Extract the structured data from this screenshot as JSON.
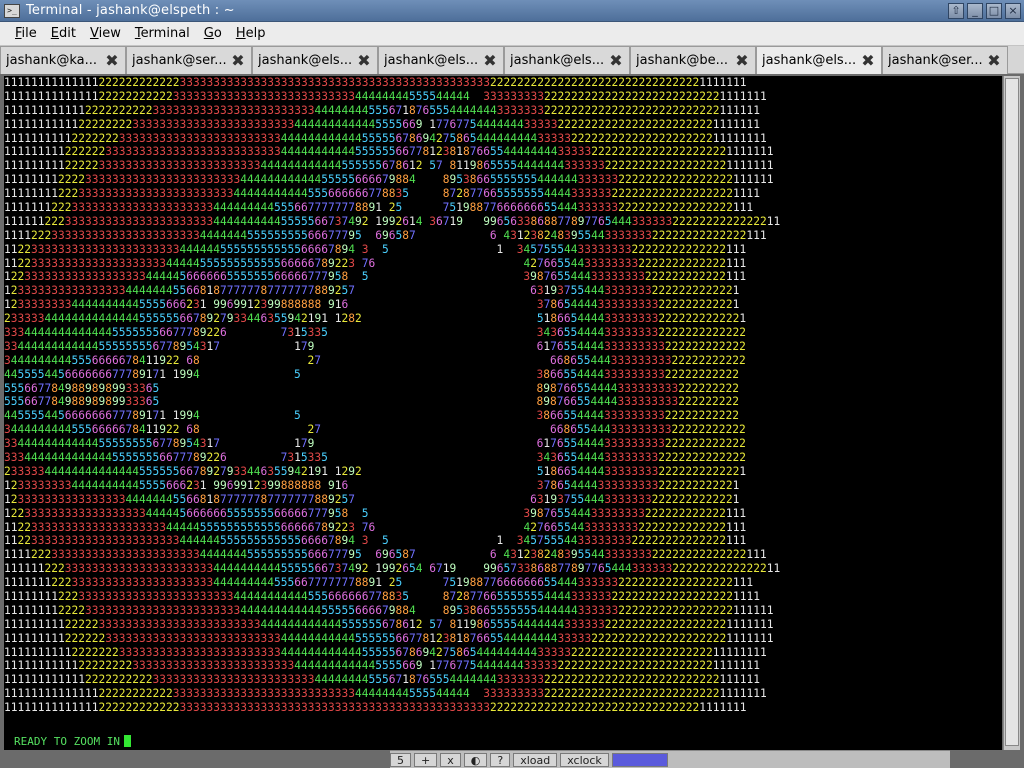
{
  "window": {
    "title": "Terminal - jashank@elspeth : ~"
  },
  "menu": [
    "File",
    "Edit",
    "View",
    "Terminal",
    "Go",
    "Help"
  ],
  "menu_mnemonic": [
    "F",
    "E",
    "V",
    "T",
    "G",
    "H"
  ],
  "tabs": [
    {
      "label": "jashank@ka..."
    },
    {
      "label": "jashank@ser..."
    },
    {
      "label": "jashank@els..."
    },
    {
      "label": "jashank@els..."
    },
    {
      "label": "jashank@els..."
    },
    {
      "label": "jashank@be..."
    },
    {
      "label": "jashank@els..."
    },
    {
      "label": "jashank@ser..."
    }
  ],
  "active_tab": 6,
  "terminal": {
    "status": "READY TO ZOOM IN",
    "colors": {
      "1": "#e8e8e8",
      "2": "#e8e83a",
      "3": "#e04848",
      "4": "#50e050",
      "5": "#4ad0ff",
      "6": "#e070e0",
      "7": "#7070ff",
      "8": "#ff9f40",
      "9": "#c0ffc0"
    },
    "lines": [
      "11111111111111222222222222333333333333333333333333333333333333333333333322222222222222222222222222222221111111",
      "111111111111112222222222233333333333333333333333333344444444555544444  333333333222222222222222222222222221111111",
      "1111111111112222222222333333333333333333333333444444445556718765554444444333333322222222222222222222222222111111",
      "11111111111222222223333333333333333333333334444444444445555669 1776775444444433333222222222222222222222221111111",
      "11111111112222222333333333333333333333333444444444444555556786942758654444444443333322222222222222222222211111111",
      "111111111222222333333333333333333333333334444444444455555566778123818766554444444433333222222222222222222221111111",
      "11111111122222333333333333333333333333444444444444555555678612 57 811986555544444443333332222222222222222221111111",
      "1111111122223333333333333333333333344444444444455555666679884    8953866555555544444433333322222222222222222111111",
      "111111112223333333333333333333333344444444444555666666778835     87287766555555544443333332222222222222222221111",
      "11111112223333333333333333333334444444445556677777778891 25      7519887766666665544433333322222222222222222111",
      "111111222333333333333333333333344444444445555566737492 1992614 36719   99656338688778977654443333332222222222222211",
      "11112223333333333333333333333444444455555555566677795  696587           6 431238248395544333333322222222222222111",
      "1122333333333333333333333344444455555555555566667894 3  5                1  3457555443333333322222222222222111",
      "1122333333333333333333334444455555555555566666789223 76                      427665544333333332222222222222111",
      "122333333333333333333444445666666555555566666777958  5                       398765544433333333222222222222111",
      "1233333333333333334444444556681877777787777777889257                          6319375544433333332222222222221",
      "123333333344444444445555666231 9969912399888888 916                            378654444333333333222222222221",
      "233333444444444444445555556678927933446355942191 1282                          5186654444333333332222222222221",
      "333444444444444455555556677789226        7315335                               3436554444333333332222222222222",
      "33444444444444555555556778954317           179                                 6176554444333333333222222222222",
      "34444444445556666678411922 68                27                                  66865544433333333322222222222",
      "445555445666666677789171 1994              5                                   386655444433333333322222222222",
      "55566778498898989933365                                                        898766554444333333333222222222",
      "55566778498898989933365                                                        898766554444333333333222222222",
      "445555445666666677789171 1994              5                                   386655444433333333322222222222",
      "34444444445556666678411922 68                27                                  66865544433333333322222222222",
      "33444444444444555555556778954317           179                                 6176554444333333333222222222222",
      "333444444444444455555556677789226        7315335                               3436554444333333332222222222222",
      "233333444444444444445555556678927933446355942191 1292                          5186654444333333332222222222221",
      "123333333344444444445555666231 9969912399888888 916                            378654444333333333222222222221",
      "1233333333333333334444444556681877777787777777889257                          6319375544433333332222222222221",
      "122333333333333333333444445666666555555566666777958  5                       398765544433333333222222222222111",
      "1122333333333333333333334444455555555555566666789223 76                      427665544333333332222222222222111",
      "1122333333333333333333333344444455555555555566667894 3  5                1  3457555443333333322222222222222111",
      "11112223333333333333333333333444444455555555566677795  696587           6 431238248395544333333322222222222222111",
      "111111222333333333333333333333344444444445555566737492 1992654 6719    99657338688778977654443333332222222222222211",
      "11111112223333333333333333333334444444445556677777778891 25      7519887766666665544433333322222222222222222111",
      "111111112223333333333333333333333344444444444555666666778835     87287766555555544443333332222222222222222221111",
      "1111111122223333333333333333333333344444444444455555666679884    8953866555555544444433333322222222222222222111111",
      "11111111122222333333333333333333333333444444444444555555678612 57 811986555544444443333332222222222222222221111111",
      "111111111222222333333333333333333333333334444444444455555566778123818766554444444433333222222222222222222221111111",
      "11111111112222222333333333333333333333333444444444444555556786942758654444444443333322222222222222222222211111111",
      "11111111111222222223333333333333333333333334444444444445555669 1776775444444433333222222222222222222222221111111",
      "1111111111112222222222333333333333333333333333444444445556718765554444444333333322222222222222222222222222111111",
      "111111111111112222222222233333333333333333333333333344444444555544444  333333333222222222222222222222222221111111",
      "11111111111111222222222222333333333333333333333333333333333333333333333322222222222222222222222222222221111111"
    ]
  },
  "taskbar": [
    "5",
    "+",
    "x",
    "◐",
    "?",
    "xload",
    "xclock",
    ""
  ]
}
